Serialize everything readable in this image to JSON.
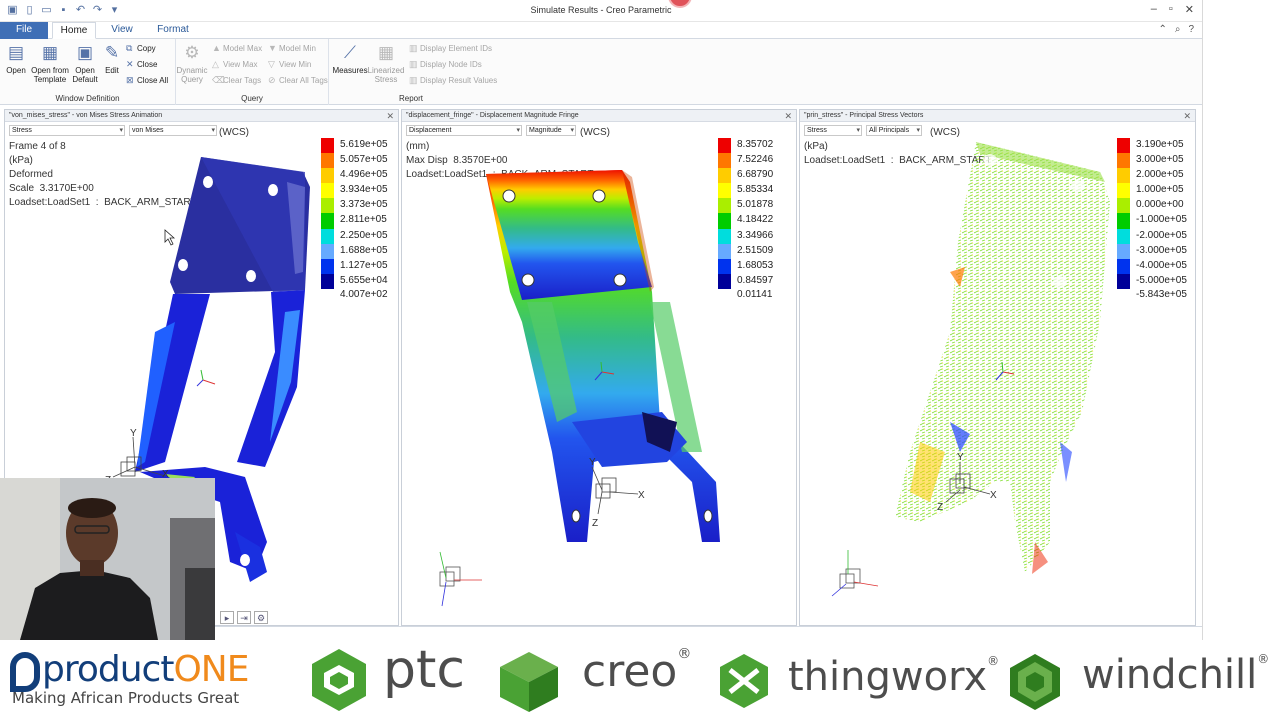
{
  "titlebar": {
    "title": "Simulate Results - Creo Parametric",
    "qat_icons": [
      "app-icon",
      "new-icon",
      "open-icon",
      "save-icon",
      "undo-icon",
      "redo-icon",
      "close-icon"
    ],
    "window_controls": [
      "minimize-icon",
      "restore-icon",
      "close-icon"
    ]
  },
  "tabs": {
    "file": "File",
    "home": "Home",
    "view": "View",
    "format": "Format"
  },
  "ribbon": {
    "window_definition": {
      "label": "Window Definition",
      "open": "Open",
      "open_from_template": "Open from Template",
      "open_default": "Open Default",
      "edit": "Edit",
      "copy": "Copy",
      "close": "Close",
      "close_all": "Close All"
    },
    "query": {
      "label": "Query",
      "dynamic_query": "Dynamic Query",
      "model_max": "Model Max",
      "model_min": "Model Min",
      "view_max": "View Max",
      "view_min": "View Min",
      "clear_tags": "Clear Tags",
      "clear_all_tags": "Clear All Tags"
    },
    "report": {
      "label": "Report",
      "measures": "Measures",
      "linearized_stress": "Linearized Stress",
      "display_element_ids": "Display Element IDs",
      "display_node_ids": "Display Node IDs",
      "display_result_values": "Display Result Values"
    }
  },
  "viewports": [
    {
      "title": "\"von_mises_stress\" - von Mises Stress Animation",
      "sel1": "Stress",
      "sel2": "von Mises",
      "wcs": "(WCS)",
      "info": "Frame 4 of 8\n(kPa)\nDeformed\nScale  3.3170E+00\nLoadset:LoadSet1  :  BACK_ARM_START",
      "legend": [
        "5.619e+05",
        "5.057e+05",
        "4.496e+05",
        "3.934e+05",
        "3.373e+05",
        "2.811e+05",
        "2.250e+05",
        "1.688e+05",
        "1.127e+05",
        "5.655e+04"
      ],
      "legend_last": "4.007e+02"
    },
    {
      "title": "\"displacement_fringe\" - Displacement Magnitude Fringe",
      "sel1": "Displacement",
      "sel2": "Magnitude",
      "wcs": "(WCS)",
      "info": "(mm)\nMax Disp  8.3570E+00\nLoadset:LoadSet1  :  BACK_ARM_START",
      "legend": [
        "8.35702",
        "7.52246",
        "6.68790",
        "5.85334",
        "5.01878",
        "4.18422",
        "3.34966",
        "2.51509",
        "1.68053",
        "0.84597"
      ],
      "legend_last": "0.01141"
    },
    {
      "title": "\"prin_stress\" - Principal Stress Vectors",
      "sel1": "Stress",
      "sel2": "All Principals",
      "wcs": "(WCS)",
      "info": "(kPa)\nLoadset:LoadSet1  :  BACK_ARM_START",
      "legend": [
        "3.190e+05",
        "3.000e+05",
        "2.000e+05",
        "1.000e+05",
        "0.000e+00",
        "-1.000e+05",
        "-2.000e+05",
        "-3.000e+05",
        "-4.000e+05",
        "-5.000e+05"
      ],
      "legend_last": "-5.843e+05"
    }
  ],
  "legend_colors": [
    "#ee0000",
    "#ff7700",
    "#ffcc00",
    "#ffff00",
    "#aaee00",
    "#00cc00",
    "#00dddd",
    "#66aaff",
    "#0033ee",
    "#000099"
  ],
  "axis_labels": {
    "x": "X",
    "y": "Y",
    "z": "Z"
  },
  "logos": {
    "productone_product": "product",
    "productone_one": "ONE",
    "productone_tag": "Making African Products Great",
    "ptc": "ptc",
    "creo": "creo",
    "thingworx": "thingworx",
    "windchill": "windchill",
    "reg": "®"
  }
}
